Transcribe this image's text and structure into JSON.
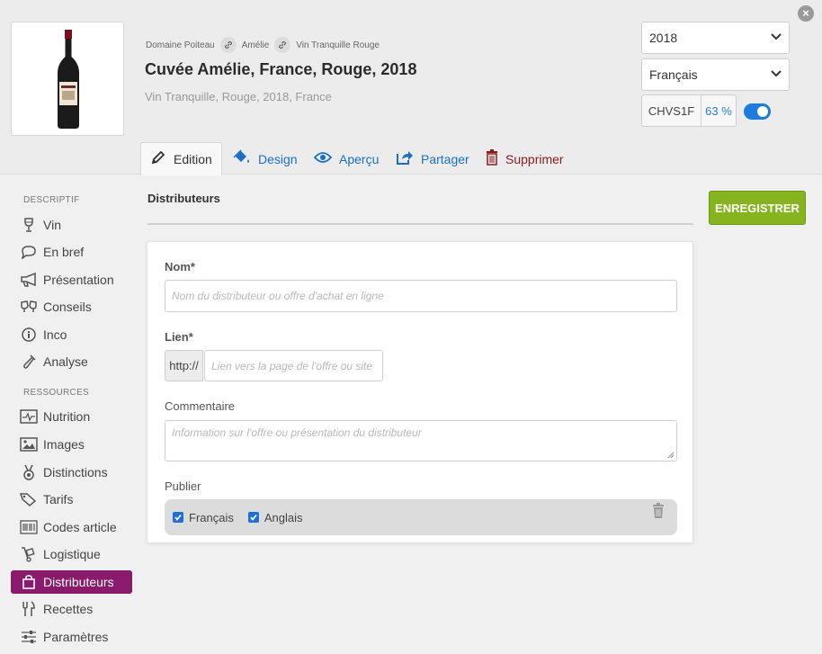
{
  "header": {
    "breadcrumb": [
      "Domaine Poiteau",
      "Amélie",
      "Vin Tranquille Rouge"
    ],
    "title": "Cuvée Amélie, France, Rouge, 2018",
    "subtitle": "Vin Tranquille, Rouge, 2018, France",
    "year_select": "2018",
    "language_select": "Français",
    "code": "CHVS1F",
    "completion": "63 %",
    "close_icon": "×"
  },
  "tabs": [
    {
      "label": "Edition",
      "icon": "pencil-icon"
    },
    {
      "label": "Design",
      "icon": "paint-bucket-icon"
    },
    {
      "label": "Aperçu",
      "icon": "eye-icon"
    },
    {
      "label": "Partager",
      "icon": "share-icon"
    },
    {
      "label": "Supprimer",
      "icon": "trash-icon"
    }
  ],
  "sidebar": {
    "section_descriptif": "DESCRIPTIF",
    "section_ressources": "RESSOURCES",
    "descriptif": [
      {
        "label": "Vin"
      },
      {
        "label": "En bref"
      },
      {
        "label": "Présentation"
      },
      {
        "label": "Conseils"
      },
      {
        "label": "Inco"
      },
      {
        "label": "Analyse"
      }
    ],
    "ressources": [
      {
        "label": "Nutrition"
      },
      {
        "label": "Images"
      },
      {
        "label": "Distinctions"
      },
      {
        "label": "Tarifs"
      },
      {
        "label": "Codes article"
      },
      {
        "label": "Logistique"
      },
      {
        "label": "Distributeurs"
      },
      {
        "label": "Recettes"
      },
      {
        "label": "Paramètres"
      }
    ]
  },
  "main": {
    "title": "Distributeurs",
    "save_label": "ENREGISTRER",
    "form": {
      "nom_label": "Nom*",
      "nom_placeholder": "Nom du distributeur ou offre d'achat en ligne",
      "lien_label": "Lien*",
      "lien_prefix": "http://",
      "lien_placeholder": "Lien vers la page de l'offre ou site",
      "commentaire_label": "Commentaire",
      "commentaire_placeholder": "Information sur l'offre ou présentation du distributeur",
      "publier_label": "Publier",
      "publish_options": [
        {
          "label": "Français",
          "checked": true
        },
        {
          "label": "Anglais",
          "checked": true
        }
      ]
    }
  },
  "colors": {
    "accent": "#8a1a6b",
    "link": "#1a6fc4",
    "save": "#86b41e",
    "toggle": "#1e7be0"
  }
}
